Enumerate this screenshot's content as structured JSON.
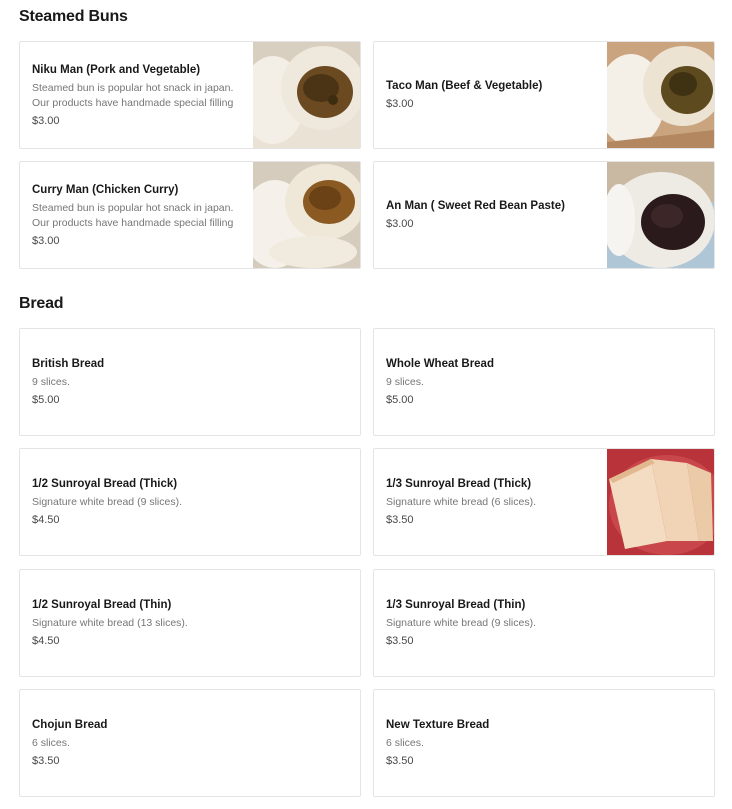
{
  "sections": [
    {
      "title": "Steamed Buns",
      "items": [
        {
          "name": "Niku Man (Pork and Vegetable)",
          "desc": "Steamed bun is popular hot snack in japan. Our products have handmade special filling",
          "price": "$3.00",
          "image": "bun-meat-photo"
        },
        {
          "name": "Taco Man (Beef & Vegetable)",
          "desc": "",
          "price": "$3.00",
          "image": "bun-meat-photo"
        },
        {
          "name": "Curry Man (Chicken Curry)",
          "desc": "Steamed bun is popular hot snack in japan. Our products have handmade special filling",
          "price": "$3.00",
          "image": "bun-curry-photo"
        },
        {
          "name": "An Man ( Sweet Red Bean Paste)",
          "desc": "",
          "price": "$3.00",
          "image": "bun-redbean-photo"
        }
      ]
    },
    {
      "title": "Bread",
      "items": [
        {
          "name": "British Bread",
          "desc": "9 slices.",
          "price": "$5.00"
        },
        {
          "name": "Whole Wheat Bread",
          "desc": "9 slices.",
          "price": "$5.00"
        },
        {
          "name": "1/2 Sunroyal Bread (Thick)",
          "desc": "Signature white bread (9 slices).",
          "price": "$4.50"
        },
        {
          "name": "1/3 Sunroyal Bread (Thick)",
          "desc": "Signature white bread (6 slices).",
          "price": "$3.50",
          "image": "bread-slices-photo"
        },
        {
          "name": "1/2 Sunroyal Bread (Thin)",
          "desc": "Signature white bread (13 slices).",
          "price": "$4.50"
        },
        {
          "name": "1/3 Sunroyal Bread (Thin)",
          "desc": "Signature white bread (9 slices).",
          "price": "$3.50"
        },
        {
          "name": "Chojun Bread",
          "desc": "6 slices.",
          "price": "$3.50"
        },
        {
          "name": "New Texture Bread",
          "desc": "6 slices.",
          "price": "$3.50"
        }
      ]
    }
  ]
}
